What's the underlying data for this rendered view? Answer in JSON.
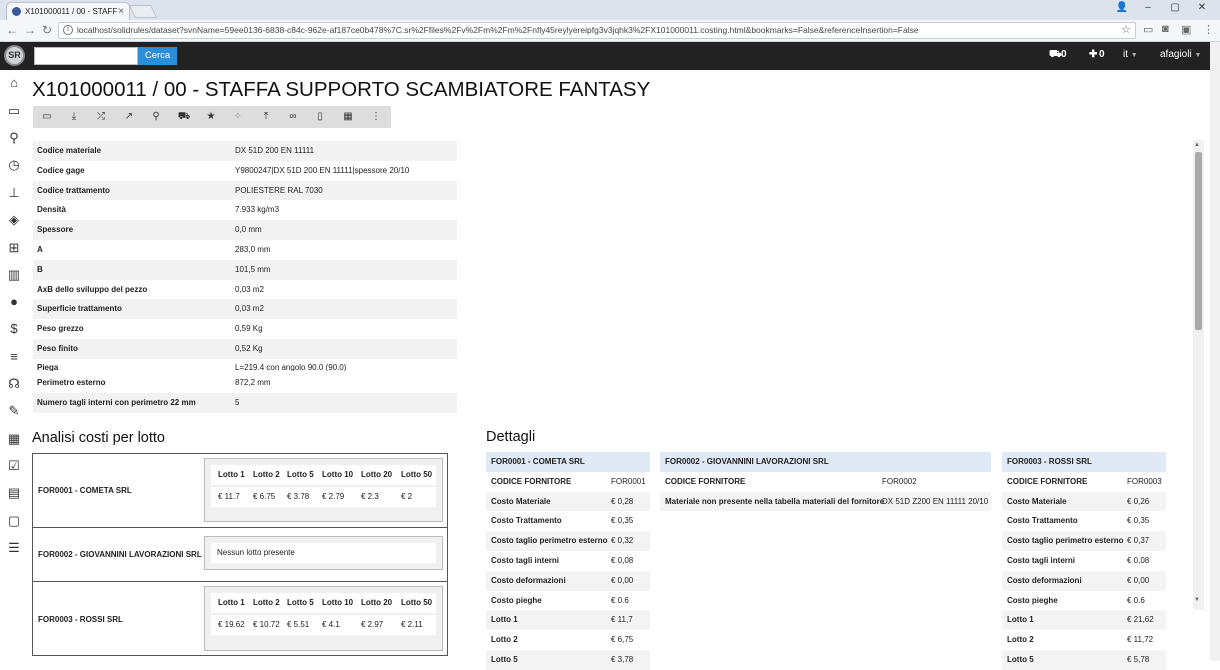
{
  "browser": {
    "tab_title": "X101000011 / 00 - STAFF",
    "url": "localhost/solidrules/dataset?svnName=59ee0136-6838-c84c-962e-af187ce0b478%7C.sr%2Ffiles%2Fv%2Fm%2Fm%2Fnfly45reylyereipfg3v3jqhk3%2FX101000011.costing.html&bookmarks=False&referenceInsertion=False"
  },
  "appbar": {
    "search_placeholder": "",
    "search_button": "Cerca",
    "count1": "0",
    "count2": "0",
    "lang": "it",
    "user": "afagioli"
  },
  "page": {
    "title": "X101000011 / 00 - STAFFA SUPPORTO SCAMBIATORE FANTASY"
  },
  "properties": [
    {
      "k": "Codice materiale",
      "v": "DX 51D 200 EN 11111"
    },
    {
      "k": "Codice gage",
      "v": "Y9800247|DX 51D 200 EN 11111|spessore 20/10"
    },
    {
      "k": "Codice trattamento",
      "v": "POLIESTERE RAL 7030"
    },
    {
      "k": "Densità",
      "v": "7.933 kg/m3"
    },
    {
      "k": "Spessore",
      "v": "0,0 mm"
    },
    {
      "k": "A",
      "v": "283,0 mm"
    },
    {
      "k": "B",
      "v": "101,5 mm"
    },
    {
      "k": "AxB dello sviluppo del pezzo",
      "v": "0,03 m2"
    },
    {
      "k": "Superficie trattamento",
      "v": "0,03 m2"
    },
    {
      "k": "Peso grezzo",
      "v": "0,59 Kg"
    },
    {
      "k": "Peso finito",
      "v": "0,52 Kg"
    },
    {
      "k": "Piega",
      "v": "L=219.4 con angolo 90.0 (90.0)"
    }
  ],
  "properties2": [
    {
      "k": "Perimetro esterno",
      "v": "872,2 mm"
    },
    {
      "k": "Numero tagli interni con perimetro 22 mm",
      "v": "5"
    }
  ],
  "analisi": {
    "title": "Analisi costi per lotto",
    "rows": [
      {
        "supplier": "FOR0001 - COMETA SRL",
        "lots": [
          "Lotto 1",
          "Lotto 2",
          "Lotto 5",
          "Lotto 10",
          "Lotto 20",
          "Lotto 50"
        ],
        "values": [
          "€ 11.7",
          "€ 6.75",
          "€ 3.78",
          "€ 2.79",
          "€ 2.3",
          "€ 2"
        ]
      },
      {
        "supplier": "FOR0002 - GIOVANNINI LAVORAZIONI SRL",
        "empty": "Nessun lotto presente"
      },
      {
        "supplier": "FOR0003 - ROSSI SRL",
        "lots": [
          "Lotto 1",
          "Lotto 2",
          "Lotto 5",
          "Lotto 10",
          "Lotto 20",
          "Lotto 50"
        ],
        "values": [
          "€ 19.62",
          "€ 10.72",
          "€ 5.51",
          "€ 4.1",
          "€ 2.97",
          "€ 2.11"
        ]
      }
    ]
  },
  "dettagli": {
    "title": "Dettagli",
    "cards": [
      {
        "header": "FOR0001 - COMETA SRL",
        "rows": [
          {
            "k": "CODICE FORNITORE",
            "v": "FOR0001"
          },
          {
            "k": "Costo Materiale",
            "v": "€ 0,28"
          },
          {
            "k": "Costo Trattamento",
            "v": "€ 0,35"
          },
          {
            "k": "Costo taglio perimetro esterno",
            "v": "€ 0,32"
          },
          {
            "k": "Costo tagli interni",
            "v": "€ 0,08"
          },
          {
            "k": "Costo deformazioni",
            "v": "€ 0,00"
          },
          {
            "k": "Costo pieghe",
            "v": "€ 0.6"
          },
          {
            "k": "Lotto 1",
            "v": "€ 11,7"
          },
          {
            "k": "Lotto 2",
            "v": "€ 6,75"
          },
          {
            "k": "Lotto 5",
            "v": "€ 3,78"
          }
        ]
      },
      {
        "header": "FOR0002 - GIOVANNINI LAVORAZIONI SRL",
        "rows": [
          {
            "k": "CODICE FORNITORE",
            "v": "FOR0002"
          },
          {
            "k": "Materiale non presente nella tabella materiali del fornitore",
            "v": "DX 51D Z200 EN 11111 20/10"
          }
        ]
      },
      {
        "header": "FOR0003 - ROSSI SRL",
        "rows": [
          {
            "k": "CODICE FORNITORE",
            "v": "FOR0003"
          },
          {
            "k": "Costo Materiale",
            "v": "€ 0,26"
          },
          {
            "k": "Costo Trattamento",
            "v": "€ 0,35"
          },
          {
            "k": "Costo taglio perimetro esterno",
            "v": "€ 0,37"
          },
          {
            "k": "Costo tagli interni",
            "v": "€ 0,08"
          },
          {
            "k": "Costo deformazioni",
            "v": "€ 0,00"
          },
          {
            "k": "Costo pieghe",
            "v": "€ 0.6"
          },
          {
            "k": "Lotto 1",
            "v": "€ 21,62"
          },
          {
            "k": "Lotto 2",
            "v": "€ 11,72"
          },
          {
            "k": "Lotto 5",
            "v": "€ 5,78"
          }
        ]
      }
    ]
  }
}
